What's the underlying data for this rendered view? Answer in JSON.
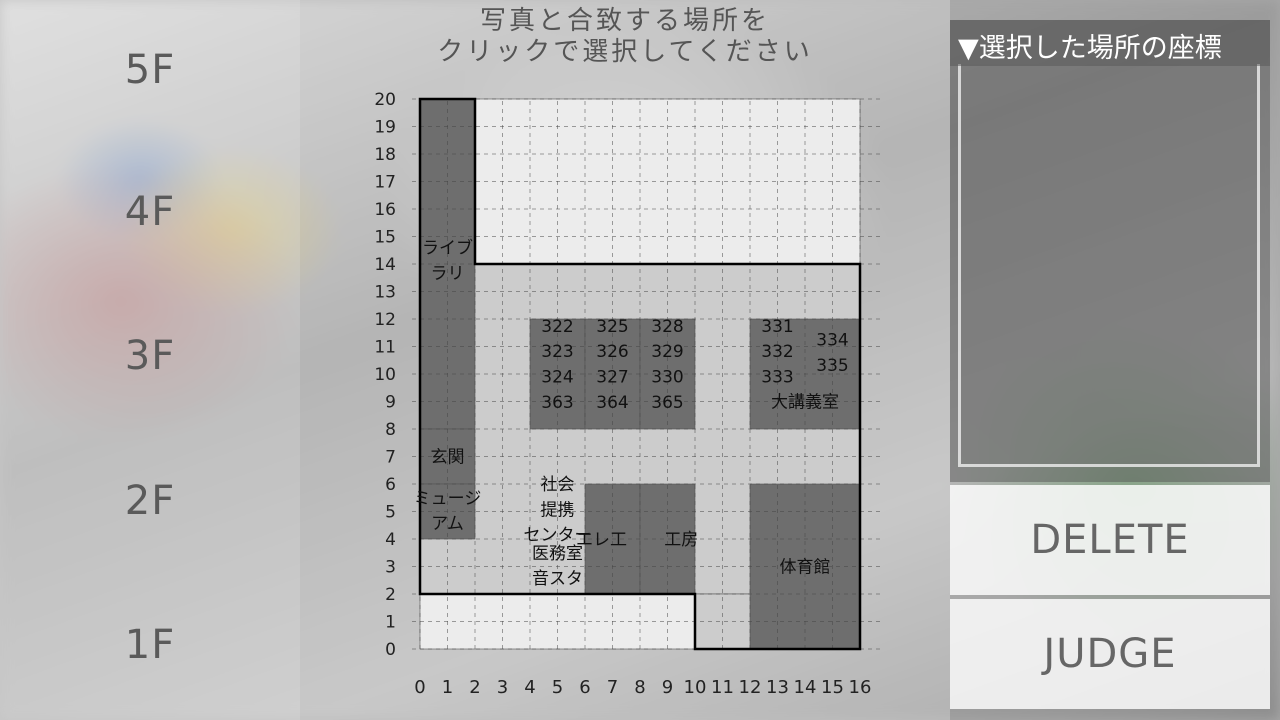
{
  "floors": [
    "5F",
    "4F",
    "3F",
    "2F",
    "1F"
  ],
  "instruction": {
    "line1": "写真と合致する場所を",
    "line2": "クリックで選択してください"
  },
  "map": {
    "x_ticks": [
      "0",
      "1",
      "2",
      "3",
      "4",
      "5",
      "6",
      "7",
      "8",
      "9",
      "10",
      "11",
      "12",
      "13",
      "14",
      "15",
      "16"
    ],
    "y_ticks": [
      "0",
      "1",
      "2",
      "3",
      "4",
      "5",
      "6",
      "7",
      "8",
      "9",
      "10",
      "11",
      "12",
      "13",
      "14",
      "15",
      "16",
      "17",
      "18",
      "19",
      "20"
    ],
    "rooms": [
      {
        "label": "ライブ\nラリ",
        "shade": "dark"
      },
      {
        "label": "322\n323\n324\n363",
        "shade": "dark"
      },
      {
        "label": "325\n326\n327\n364",
        "shade": "dark"
      },
      {
        "label": "328\n329\n330\n365",
        "shade": "dark"
      },
      {
        "label": "331\n332\n333",
        "shade": "dark"
      },
      {
        "label": "334\n335",
        "shade": "dark"
      },
      {
        "label": "大講義室",
        "shade": "dark"
      },
      {
        "label": "玄関",
        "shade": "dark"
      },
      {
        "label": "ミュージ\nアム",
        "shade": "dark"
      },
      {
        "label": "社会\n提携\nセンター",
        "shade": "light"
      },
      {
        "label": "医務室\n音スタ",
        "shade": "light"
      },
      {
        "label": "エレ工",
        "shade": "dark"
      },
      {
        "label": "工房",
        "shade": "dark"
      },
      {
        "label": "体育館",
        "shade": "dark"
      }
    ]
  },
  "coords_panel": {
    "title": "▼選択した場所の座標",
    "value": ""
  },
  "buttons": {
    "delete": "DELETE",
    "judge": "JUDGE"
  },
  "colors": {
    "dark_cell": "#6e6e6e",
    "light_cell": "#cccccc",
    "empty_cell": "#ececec",
    "outline": "#000000"
  }
}
